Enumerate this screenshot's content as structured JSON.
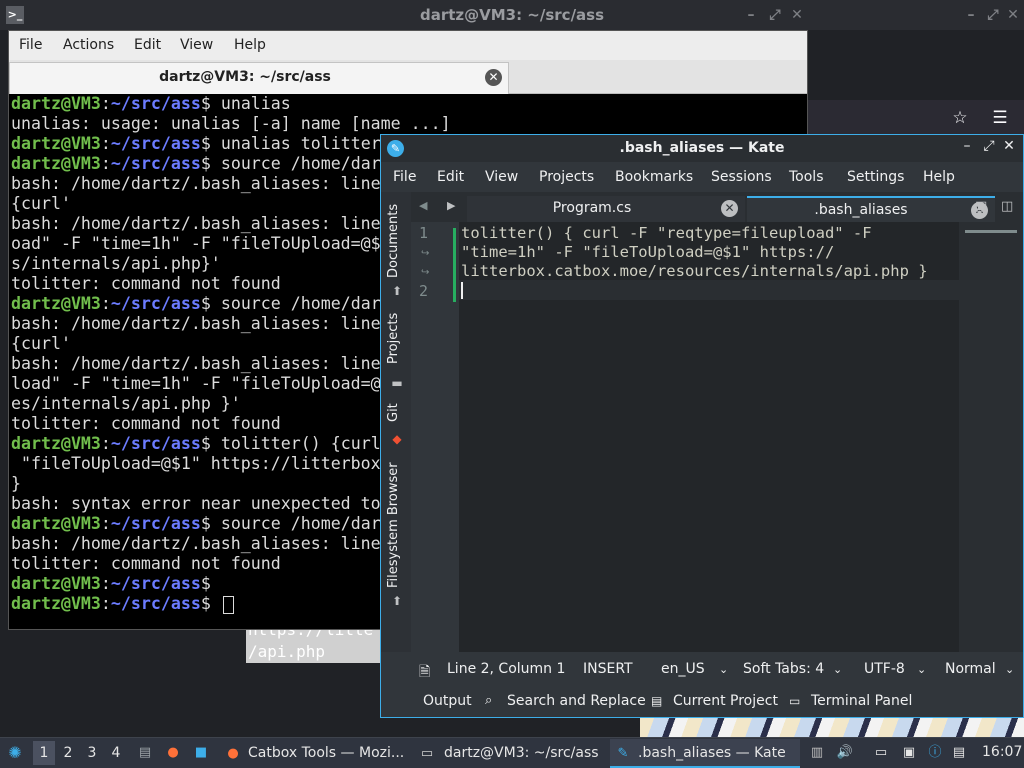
{
  "background": {
    "title": "dartz@VM3: ~/src/ass",
    "highlight_lines": [
      "https://litte",
      "/api.php"
    ]
  },
  "terminal": {
    "menu": [
      "File",
      "Actions",
      "Edit",
      "View",
      "Help"
    ],
    "tab_title": "dartz@VM3: ~/src/ass",
    "prompt_user": "dartz@VM3",
    "prompt_sep": ":",
    "prompt_path": "~/src/ass",
    "prompt_symbol": "$",
    "lines": [
      {
        "prompt": true,
        "text": " unalias"
      },
      {
        "prompt": false,
        "text": "unalias: usage: unalias [-a] name [name ...]"
      },
      {
        "prompt": true,
        "text": " unalias tolitter"
      },
      {
        "prompt": true,
        "text": " source /home/dartz/.bash_aliases"
      },
      {
        "prompt": false,
        "text": "bash: /home/dartz/.bash_aliases: line"
      },
      {
        "prompt": false,
        "text": "{curl'"
      },
      {
        "prompt": false,
        "text": "bash: /home/dartz/.bash_aliases: line"
      },
      {
        "prompt": false,
        "text": "oad\" -F \"time=1h\" -F \"fileToUpload=@$"
      },
      {
        "prompt": false,
        "text": "s/internals/api.php}'"
      },
      {
        "prompt": false,
        "text": "tolitter: command not found"
      },
      {
        "prompt": true,
        "text": " source /home/dartz/.bash_aliases"
      },
      {
        "prompt": false,
        "text": "bash: /home/dartz/.bash_aliases: line"
      },
      {
        "prompt": false,
        "text": "{curl'"
      },
      {
        "prompt": false,
        "text": "bash: /home/dartz/.bash_aliases: line"
      },
      {
        "prompt": false,
        "text": "load\" -F \"time=1h\" -F \"fileToUpload=@"
      },
      {
        "prompt": false,
        "text": "es/internals/api.php }'"
      },
      {
        "prompt": false,
        "text": "tolitter: command not found"
      },
      {
        "prompt": true,
        "text": " tolitter() {curl"
      },
      {
        "prompt": false,
        "text": " \"fileToUpload=@$1\" https://litterbox"
      },
      {
        "prompt": false,
        "text": "}"
      },
      {
        "prompt": false,
        "text": "bash: syntax error near unexpected token"
      },
      {
        "prompt": true,
        "text": " source /home/dartz/.bash_aliases"
      },
      {
        "prompt": false,
        "text": "bash: /home/dartz/.bash_aliases: line"
      },
      {
        "prompt": false,
        "text": "tolitter: command not found"
      },
      {
        "prompt": true,
        "text": ""
      },
      {
        "prompt": true,
        "text": " ",
        "cursor": true
      }
    ]
  },
  "kate": {
    "title": ".bash_aliases  — Kate",
    "menu": [
      "File",
      "Edit",
      "View",
      "Projects",
      "Bookmarks",
      "Sessions",
      "Tools",
      "Settings",
      "Help"
    ],
    "sidebar": [
      "Documents",
      "Projects",
      "Git",
      "Filesystem Browser"
    ],
    "tabs": [
      {
        "label": "Program.cs",
        "active": false
      },
      {
        "label": ".bash_aliases",
        "active": true
      }
    ],
    "line_numbers": [
      "1",
      "2"
    ],
    "code_lines": [
      "tolitter() { curl -F \"reqtype=fileupload\" -F",
      "\"time=1h\" -F \"fileToUpload=@$1\" https://",
      "litterbox.catbox.moe/resources/internals/api.php }"
    ],
    "status": {
      "position": "Line 2, Column 1",
      "mode": "INSERT",
      "language": "en_US",
      "indent": "Soft Tabs: 4",
      "encoding": "UTF-8",
      "input_mode": "Normal"
    },
    "toolviews": [
      "Output",
      "Search and Replace",
      "Current Project",
      "Terminal Panel"
    ]
  },
  "taskbar": {
    "workspaces": [
      "1",
      "2",
      "3",
      "4"
    ],
    "tasks": [
      {
        "label": "Catbox Tools — Mozi...",
        "icon": "firefox-icon"
      },
      {
        "label": "dartz@VM3: ~/src/ass",
        "icon": "terminal-icon"
      },
      {
        "label": ".bash_aliases  — Kate",
        "icon": "kate-icon"
      }
    ],
    "clock": "16:07"
  }
}
